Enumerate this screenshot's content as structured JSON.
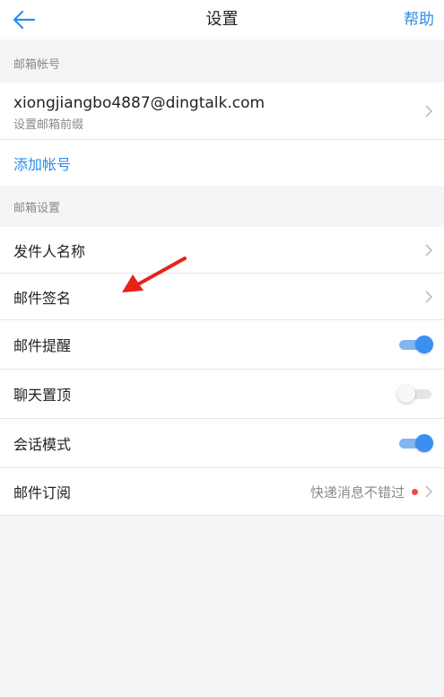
{
  "nav": {
    "title": "设置",
    "help": "帮助",
    "back_icon": "arrow-left-icon"
  },
  "sections": {
    "mail_account": "邮箱帐号",
    "mail_settings": "邮箱设置"
  },
  "account": {
    "email": "xiongjiangbo4887@dingtalk.com",
    "subtitle": "设置邮箱前缀",
    "add": "添加帐号"
  },
  "settings": {
    "sender_name": "发件人名称",
    "signature": "邮件签名",
    "reminder": "邮件提醒",
    "reminder_on": true,
    "pin_chat": "聊天置顶",
    "pin_chat_on": false,
    "conversation_mode": "会话模式",
    "conversation_mode_on": true,
    "subscription": "邮件订阅",
    "subscription_value": "快递消息不错过"
  },
  "colors": {
    "accent": "#2b8ee8",
    "toggle_on": "#3a8ff0",
    "red_dot": "#f0494a",
    "annotation_arrow": "#e8221b"
  }
}
